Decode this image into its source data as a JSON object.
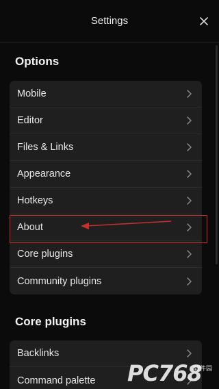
{
  "header": {
    "title": "Settings",
    "close_icon": "close-icon"
  },
  "options_section": {
    "title": "Options",
    "items": [
      {
        "label": "Mobile"
      },
      {
        "label": "Editor"
      },
      {
        "label": "Files & Links"
      },
      {
        "label": "Appearance"
      },
      {
        "label": "Hotkeys"
      },
      {
        "label": "About"
      },
      {
        "label": "Core plugins"
      },
      {
        "label": "Community plugins"
      }
    ]
  },
  "core_plugins_section": {
    "title": "Core plugins",
    "items": [
      {
        "label": "Backlinks"
      },
      {
        "label": "Command palette"
      }
    ]
  },
  "annotation": {
    "highlighted_item": "About",
    "color": "#c8302c"
  },
  "watermark": {
    "text": "PC768",
    "subtext": "软件园"
  }
}
